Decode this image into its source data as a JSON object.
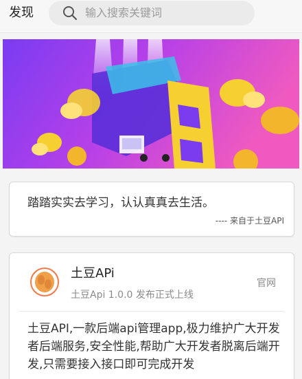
{
  "header": {
    "title": "发现",
    "search_placeholder": "输入搜索关键词",
    "search_icon": "search-icon"
  },
  "banner": {
    "dot_count": 2,
    "active_dot": 1,
    "colors": {
      "purple": "#7b3cf0",
      "pink": "#f04cc2",
      "yellow": "#f6d030"
    }
  },
  "quote": {
    "text": "踏踏实实去学习，认认真真去生活。",
    "source": "---- 来自于土豆API"
  },
  "app_card": {
    "name": "土豆APi",
    "version": "土豆Api 1.0.0 发布正式上线",
    "official_link": "官网",
    "description": "土豆API,一款后端api管理app,极力维护广大开发者后端服务,安全性能,帮助广大开发者脱离后端开发,只需要接入接口即可完成开发",
    "logo_icon": "potato-logo-icon"
  }
}
